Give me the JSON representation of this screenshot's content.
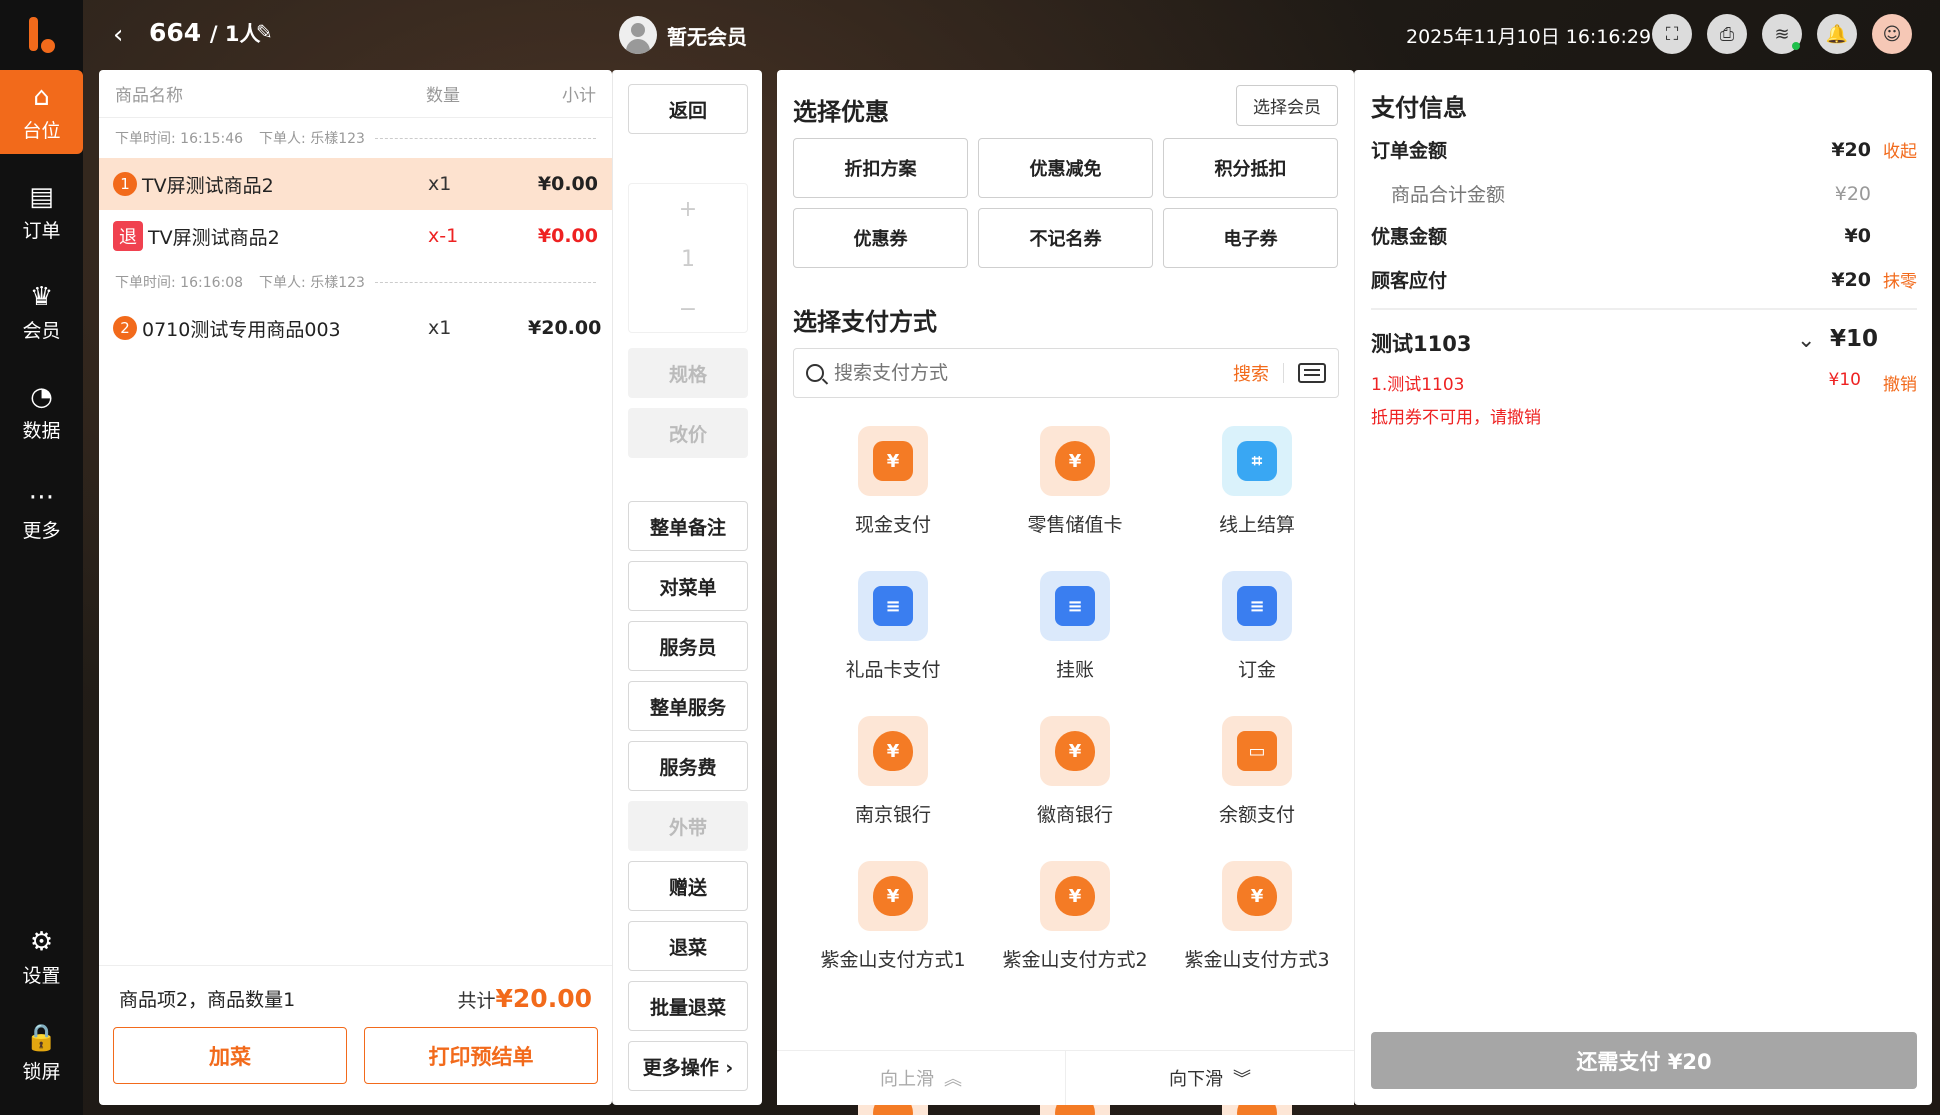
{
  "nav": {
    "items": [
      {
        "label": "台位",
        "icon": "table-icon",
        "active": true
      },
      {
        "label": "订单",
        "icon": "order-icon",
        "active": false
      },
      {
        "label": "会员",
        "icon": "member-icon",
        "active": false
      },
      {
        "label": "数据",
        "icon": "chart-icon",
        "active": false
      },
      {
        "label": "更多",
        "icon": "more-icon",
        "active": false
      }
    ],
    "bottom": [
      {
        "label": "设置",
        "icon": "gear-icon"
      },
      {
        "label": "锁屏",
        "icon": "lock-icon"
      }
    ]
  },
  "header": {
    "table_no": "664",
    "people": "/ 1人",
    "member_status": "暂无会员",
    "datetime": "2025年11月10日 16:16:29"
  },
  "order": {
    "columns": [
      "商品名称",
      "数量",
      "小计"
    ],
    "batches": [
      {
        "time": "下单时间: 16:15:46",
        "by": "下单人: 乐樣123"
      },
      {
        "time": "下单时间: 16:16:08",
        "by": "下单人: 乐樣123"
      }
    ],
    "items": [
      {
        "badge": "1",
        "name": "TV屏测试商品2",
        "qty": "x1",
        "subtotal": "¥0.00"
      },
      {
        "badge": "退",
        "name": "TV屏测试商品2",
        "qty": "x-1",
        "subtotal": "¥0.00"
      },
      {
        "badge": "2",
        "name": "0710测试专用商品003",
        "qty": "x1",
        "subtotal": "¥20.00"
      }
    ],
    "summary": "商品项2，商品数量1",
    "total_label": "共计",
    "total_value": "¥20.00",
    "add_btn": "加菜",
    "print_btn": "打印预结单"
  },
  "ops": {
    "back": "返回",
    "stepper_plus": "+",
    "stepper_value": "1",
    "stepper_minus": "−",
    "spec": "规格",
    "reprice": "改价",
    "note": "整单备注",
    "check": "对菜单",
    "waiter": "服务员",
    "service": "整单服务",
    "fee": "服务费",
    "takeout": "外带",
    "gift": "赠送",
    "refund": "退菜",
    "batch_refund": "批量退菜",
    "more": "更多操作 ›"
  },
  "discount": {
    "title": "选择优惠",
    "select_member": "选择会员",
    "options": [
      "折扣方案",
      "优惠减免",
      "积分抵扣",
      "优惠券",
      "不记名券",
      "电子券"
    ]
  },
  "payment": {
    "title": "选择支付方式",
    "search_placeholder": "搜索支付方式",
    "search_btn": "搜索",
    "methods": [
      {
        "label": "现金支付",
        "glyph": "¥"
      },
      {
        "label": "零售储值卡",
        "glyph": "¥"
      },
      {
        "label": "线上结算",
        "glyph": "⌗"
      },
      {
        "label": "礼品卡支付",
        "glyph": "≡"
      },
      {
        "label": "挂账",
        "glyph": "≡"
      },
      {
        "label": "订金",
        "glyph": "≡"
      },
      {
        "label": "南京银行",
        "glyph": "¥"
      },
      {
        "label": "徽商银行",
        "glyph": "¥"
      },
      {
        "label": "余额支付",
        "glyph": "▭"
      },
      {
        "label": "紫金山支付方式1",
        "glyph": "¥"
      },
      {
        "label": "紫金山支付方式2",
        "glyph": "¥"
      },
      {
        "label": "紫金山支付方式3",
        "glyph": "¥"
      }
    ],
    "scroll_up": "向上滑",
    "scroll_down": "向下滑"
  },
  "info": {
    "title": "支付信息",
    "order_amount_label": "订单金额",
    "order_amount": "¥20",
    "collapse": "收起",
    "goods_total_label": "商品合计金额",
    "goods_total": "¥20",
    "discount_label": "优惠金额",
    "discount": "¥0",
    "payable_label": "顾客应付",
    "payable": "¥20",
    "round_off": "抹零",
    "coupon_name": "测试1103",
    "coupon_amount": "¥10",
    "coupon_line_name": "1.测试1103",
    "coupon_line_amount": "¥10",
    "revoke": "撤销",
    "warning": "抵用券不可用，请撤销",
    "pay_btn": "还需支付 ¥20"
  },
  "colors": {
    "accent": "#f26a1b",
    "danger": "#e22222"
  }
}
